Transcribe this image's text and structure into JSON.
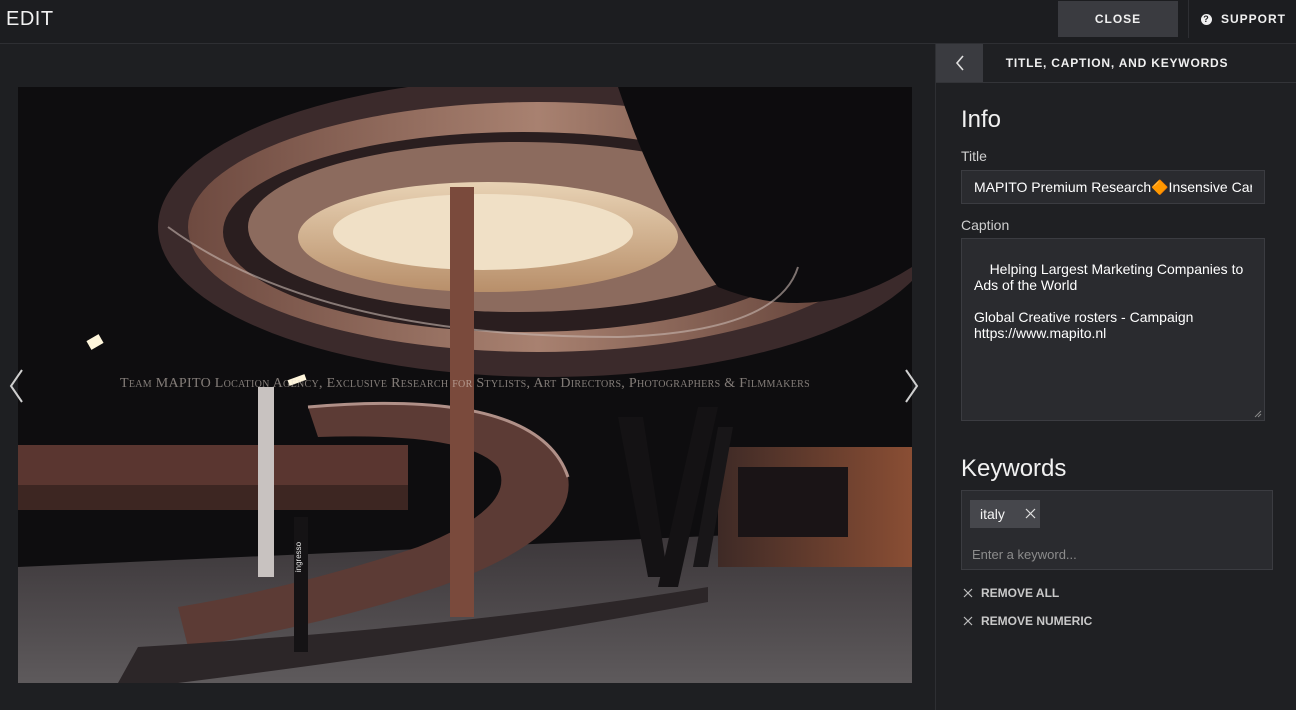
{
  "header": {
    "title": "EDIT",
    "close_label": "CLOSE",
    "support_label": "SUPPORT"
  },
  "viewer": {
    "watermark": "Team MAPITO Location Agency, Exclusive Research for Stylists, Art Directors, Photographers & Filmmakers",
    "photo_sign": "ingresso",
    "icons": {
      "prev": "chevron-left-icon",
      "next": "chevron-right-icon"
    }
  },
  "panel": {
    "title": "TITLE, CAPTION, AND KEYWORDS",
    "info_heading": "Info",
    "title_label": "Title",
    "title_value": "MAPITO Premium Research🔶Insensive Card",
    "caption_label": "Caption",
    "caption_value": "Helping Largest Marketing Companies to Ads of the World\n\nGlobal Creative rosters - Campaign https://www.mapito.nl",
    "keywords_heading": "Keywords",
    "keywords": [
      {
        "label": "italy"
      }
    ],
    "keyword_placeholder": "Enter a keyword...",
    "remove_all_label": "REMOVE ALL",
    "remove_numeric_label": "REMOVE NUMERIC"
  },
  "colors": {
    "background": "#1e1f22",
    "panel": "#1f2023",
    "button": "#3a3b40",
    "chip": "#46474c"
  }
}
